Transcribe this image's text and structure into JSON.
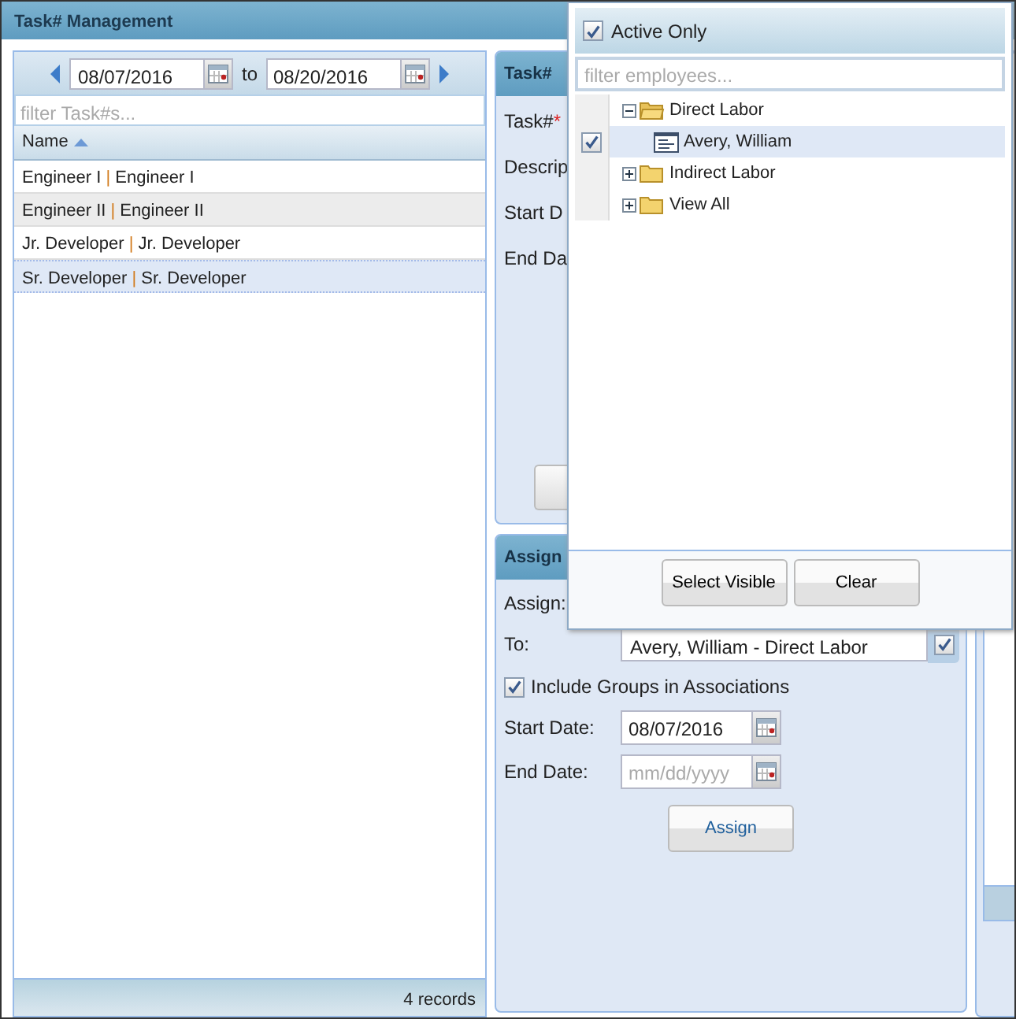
{
  "window": {
    "title": "Task# Management"
  },
  "date_range": {
    "from": "08/07/2016",
    "separator": "to",
    "to": "08/20/2016"
  },
  "task_filter": {
    "placeholder": "filter Task#s..."
  },
  "grid": {
    "column": "Name",
    "sorted": true,
    "rows": [
      {
        "left": "Engineer I",
        "sep": "|",
        "right": "Engineer I",
        "selected": false
      },
      {
        "left": "Engineer II",
        "sep": "|",
        "right": "Engineer II",
        "selected": false
      },
      {
        "left": "Jr. Developer",
        "sep": "|",
        "right": "Jr. Developer",
        "selected": false
      },
      {
        "left": "Sr. Developer",
        "sep": "|",
        "right": "Sr. Developer",
        "selected": true
      }
    ],
    "footer": "4 records"
  },
  "task_card": {
    "title": "Task#",
    "labels": [
      {
        "text": "Task#",
        "required_mark": "*"
      },
      {
        "text": "Descrip"
      },
      {
        "text": "Start D"
      },
      {
        "text": "End Da"
      }
    ]
  },
  "assign_card": {
    "title": "Assign",
    "assign_label": "Assign:",
    "to_label": "To:",
    "to_value": "Avery, William - Direct Labor",
    "to_toggle_checked": true,
    "include_groups": {
      "label": "Include Groups in Associations",
      "checked": true
    },
    "start_label": "Start Date:",
    "start_value": "08/07/2016",
    "end_label": "End Date:",
    "end_placeholder": "mm/dd/yyyy",
    "button": "Assign"
  },
  "employee_popup": {
    "active_only": {
      "label": "Active Only",
      "checked": true
    },
    "filter": {
      "placeholder": "filter employees..."
    },
    "tree": [
      {
        "kind": "group",
        "label": "Direct Labor",
        "expanded": true,
        "children": [
          {
            "kind": "employee",
            "label": "Avery, William",
            "checked": true,
            "selected": true
          }
        ]
      },
      {
        "kind": "group",
        "label": "Indirect Labor",
        "expanded": false
      },
      {
        "kind": "group",
        "label": "View All",
        "expanded": false
      }
    ],
    "buttons": [
      "Select Visible",
      "Clear"
    ]
  }
}
